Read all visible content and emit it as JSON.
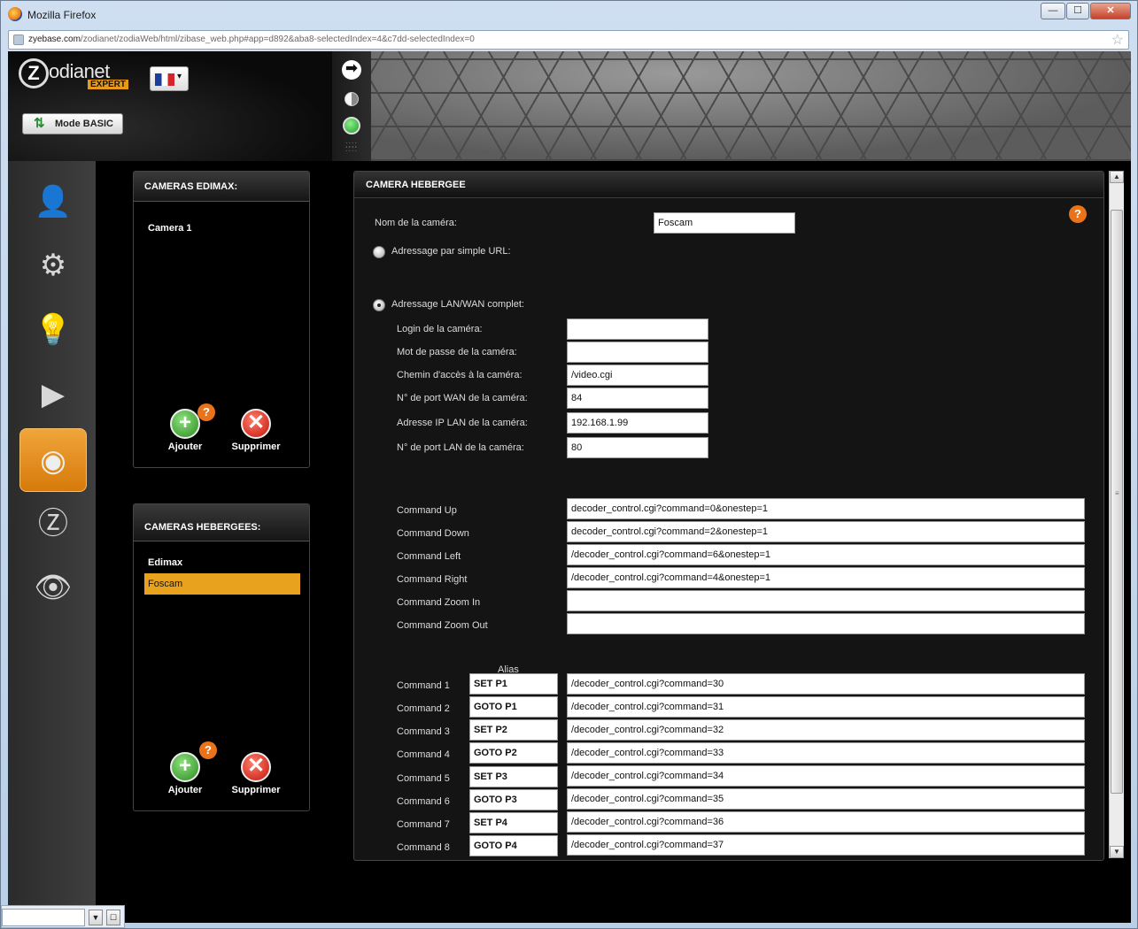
{
  "browser": {
    "title": "Mozilla Firefox",
    "url_domain": "zyebase.com",
    "url_path": "/zodianet/zodiaWeb/html/zibase_web.php#app=d892&aba8-selectedIndex=4&c7dd-selectedIndex=0",
    "min": "—",
    "max": "☐",
    "close": "✕"
  },
  "app": {
    "logo_letter": "Z",
    "logo_name": "odianet",
    "logo_sub": "EXPERT",
    "mode_button": "Mode BASIC",
    "flag_caret": "▾",
    "strip_arrow": "➡"
  },
  "nav": {
    "items": [
      {
        "icon": "👤"
      },
      {
        "icon": "⚙"
      },
      {
        "icon": "💡"
      },
      {
        "icon": "▶"
      },
      {
        "icon": "◉"
      },
      {
        "icon": "Ⓩ"
      },
      {
        "icon": "👁"
      }
    ]
  },
  "edimax_panel": {
    "title": "CAMERAS EDIMAX:",
    "items": [
      "Camera 1"
    ],
    "add_label": "Ajouter",
    "delete_label": "Supprimer",
    "help": "?"
  },
  "hosted_panel": {
    "title": "CAMERAS HEBERGEES:",
    "items": [
      "Edimax",
      "Foscam"
    ],
    "selected": "Foscam",
    "add_label": "Ajouter",
    "delete_label": "Supprimer",
    "help": "?"
  },
  "form": {
    "title": "CAMERA HEBERGEE",
    "help": "?",
    "name_label": "Nom de la caméra:",
    "name_value": "Foscam",
    "simple_url_label": "Adressage par simple URL:",
    "lan_wan_label": "Adressage LAN/WAN complet:",
    "selected_mode": "lan_wan",
    "login_label": "Login de la caméra:",
    "login_value": "",
    "password_label": "Mot de passe de la caméra:",
    "password_value": "",
    "path_label": "Chemin d'accès à la caméra:",
    "path_value": "/video.cgi",
    "wan_port_label": "N° de port WAN de la caméra:",
    "wan_port_value": "84",
    "lan_ip_label": "Adresse IP LAN de la caméra:",
    "lan_ip_value": "192.168.1.99",
    "lan_port_label": "N° de port LAN de la caméra:",
    "lan_port_value": "80",
    "commands": [
      {
        "label": "Command Up",
        "value": "decoder_control.cgi?command=0&onestep=1"
      },
      {
        "label": "Command Down",
        "value": "decoder_control.cgi?command=2&onestep=1"
      },
      {
        "label": "Command Left",
        "value": "/decoder_control.cgi?command=6&onestep=1"
      },
      {
        "label": "Command Right",
        "value": "/decoder_control.cgi?command=4&onestep=1"
      },
      {
        "label": "Command Zoom In",
        "value": ""
      },
      {
        "label": "Command Zoom Out",
        "value": ""
      }
    ],
    "alias_header": "Alias",
    "presets": [
      {
        "label": "Command 1",
        "alias": "SET P1",
        "value": "/decoder_control.cgi?command=30"
      },
      {
        "label": "Command 2",
        "alias": "GOTO P1",
        "value": "/decoder_control.cgi?command=31"
      },
      {
        "label": "Command 3",
        "alias": "SET P2",
        "value": "/decoder_control.cgi?command=32"
      },
      {
        "label": "Command 4",
        "alias": "GOTO P2",
        "value": "/decoder_control.cgi?command=33"
      },
      {
        "label": "Command 5",
        "alias": "SET P3",
        "value": "/decoder_control.cgi?command=34"
      },
      {
        "label": "Command 6",
        "alias": "GOTO P3",
        "value": "/decoder_control.cgi?command=35"
      },
      {
        "label": "Command 7",
        "alias": "SET P4",
        "value": "/decoder_control.cgi?command=36"
      },
      {
        "label": "Command 8",
        "alias": "GOTO P4",
        "value": "/decoder_control.cgi?command=37"
      }
    ]
  },
  "scrollbar": {
    "up": "▲",
    "down": "▼",
    "grip": "≡"
  },
  "statusbar": {
    "dropdown": "▼",
    "button": "☐"
  }
}
